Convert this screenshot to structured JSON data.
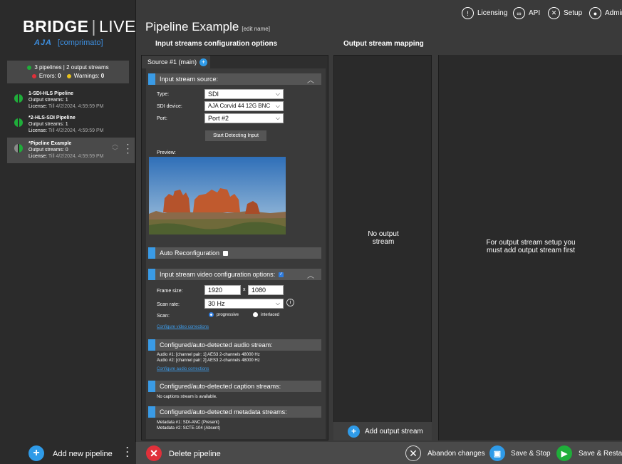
{
  "brand": {
    "title_main": "BRIDGE",
    "title_sep": "|",
    "title_live": "LIVE",
    "aja": "AJA",
    "comprimato": "[comprimato]"
  },
  "status": {
    "summary": "3 pipelines | 2 output streams",
    "errors_label": "Errors:",
    "errors": "0",
    "warnings_label": "Warnings:",
    "warnings": "0"
  },
  "pipelines": [
    {
      "name": "1-SDI-HLS Pipeline",
      "outputs": "Output streams: 1",
      "license_label": "License:",
      "license": "Till 4/2/2024, 4:59:59 PM"
    },
    {
      "name": "*2-HLS-SDI Pipeline",
      "outputs": "Output streams: 1",
      "license_label": "License:",
      "license": "Till 4/2/2024, 4:59:59 PM"
    },
    {
      "name": "*Pipeline Example",
      "outputs": "Output streams: 0",
      "license_label": "License:",
      "license": "Till 4/2/2024, 4:59:59 PM"
    }
  ],
  "header": {
    "title": "Pipeline Example",
    "edit": "[edit name]",
    "menu": {
      "licensing": "Licensing",
      "api": "API",
      "setup": "Setup",
      "admin": "Admin"
    },
    "input_section": "Input streams configuration options",
    "output_section": "Output stream mapping"
  },
  "source_tab": "Source #1 (main)",
  "input_source": {
    "heading": "Input stream source:",
    "type_label": "Type:",
    "type_value": "SDI",
    "device_label": "SDI device:",
    "device_value": "AJA Corvid 44 12G BNC",
    "port_label": "Port:",
    "port_value": "Port #2",
    "detect_button": "Start Detecting Input",
    "preview_label": "Preview:"
  },
  "auto_reconfig": "Auto Reconfiguration",
  "video_config": {
    "heading": "Input stream video configuration options:",
    "frame_label": "Frame size:",
    "width": "1920",
    "x": "x",
    "height": "1080",
    "scan_rate_label": "Scan rate:",
    "scan_rate": "30 Hz",
    "scan_label": "Scan:",
    "progressive": "progressive",
    "interlaced": "interlaced",
    "corrections_link": "Configure video corrections"
  },
  "audio": {
    "heading": "Configured/auto-detected audio stream:",
    "line1": "Audio #1: [channel pair: 1] AES3 2-channels 48000 Hz",
    "line2": "Audio #2: [channel pair: 2] AES3 2-channels 48000 Hz",
    "link": "Configure audio corrections"
  },
  "captions": {
    "heading": "Configured/auto-detected caption streams:",
    "text": "No captions stream is available."
  },
  "metadata": {
    "heading": "Configured/auto-detected metadata streams:",
    "line1": "Metadata #1: SDI-ANC (Present)",
    "line2": "Metadata #2: SCTE-104 (Absent)"
  },
  "output": {
    "empty_line1": "No output",
    "empty_line2": "stream",
    "add_button": "Add output stream",
    "hint_line1": "For output stream setup you",
    "hint_line2": "must add output stream first"
  },
  "bottom": {
    "add_pipeline": "Add new pipeline",
    "delete": "Delete pipeline",
    "abandon": "Abandon changes",
    "save_stop": "Save & Stop",
    "save_restart": "Save & Restart"
  },
  "colors": {
    "accent_blue": "#2f9be8",
    "green": "#1fae3a",
    "red": "#e0303a",
    "yellow": "#e8c21c"
  }
}
